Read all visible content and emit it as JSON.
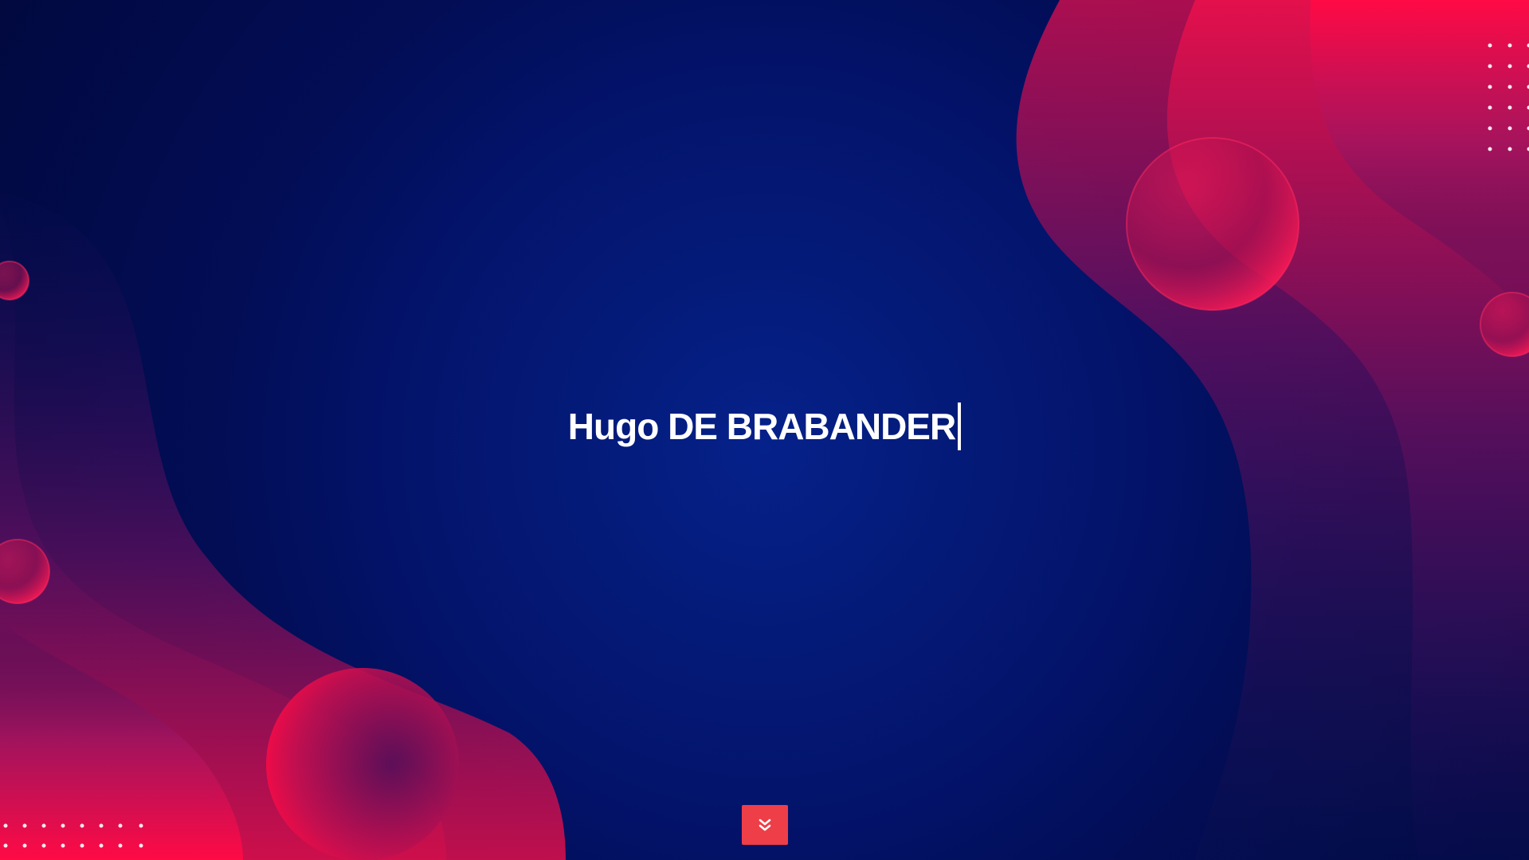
{
  "hero": {
    "title": "Hugo DE BRABANDER"
  },
  "scroll_button": {
    "icon": "double-chevron-down-icon"
  },
  "colors": {
    "background_navy": "#041a78",
    "accent_red": "#ff0a45",
    "button_red": "#ee3e48",
    "text": "#ffffff"
  }
}
